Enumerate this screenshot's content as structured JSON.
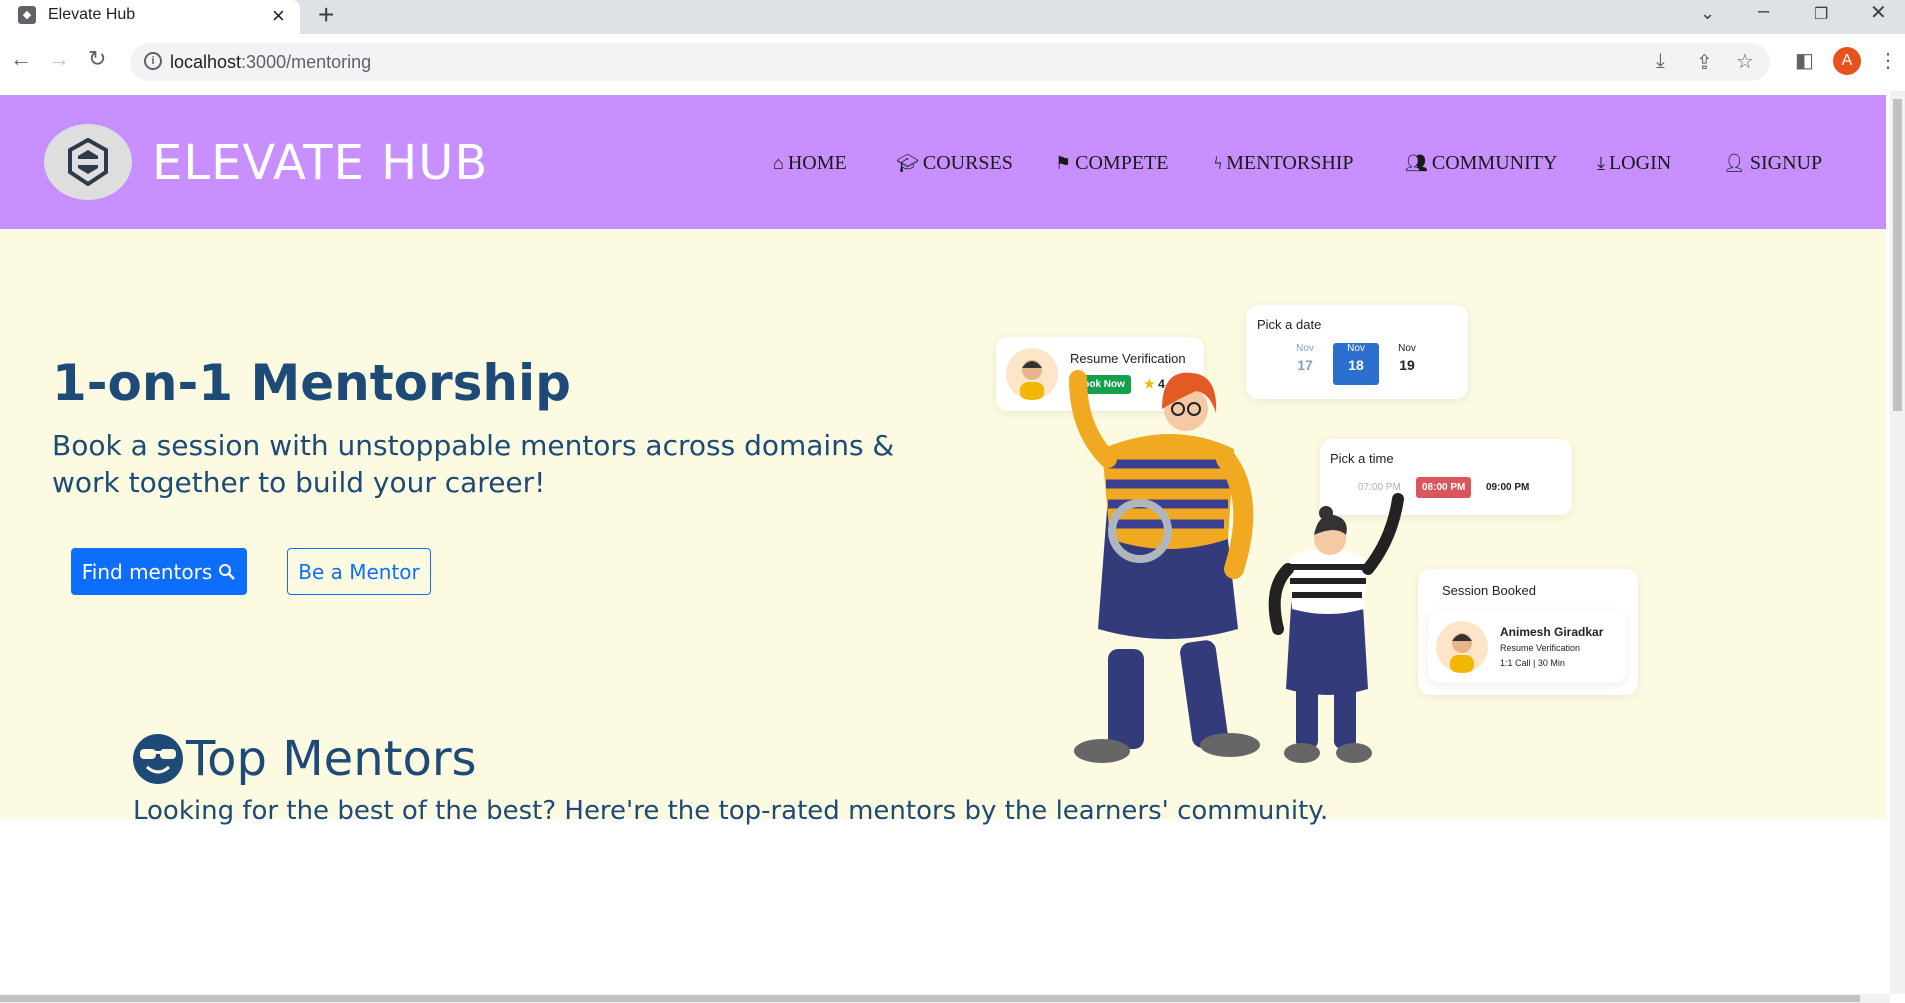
{
  "browser": {
    "tab_title": "Elevate Hub",
    "url_host": "localhost",
    "url_rest": ":3000/mentoring",
    "profile_initial": "A"
  },
  "site": {
    "brand": "ELEVATE HUB",
    "nav": [
      {
        "label": "HOME",
        "icon": "home-icon"
      },
      {
        "label": "COURSES",
        "icon": "graduation-cap-icon"
      },
      {
        "label": "COMPETE",
        "icon": "flag-icon"
      },
      {
        "label": "MENTORSHIP",
        "icon": "bolt-icon"
      },
      {
        "label": "COMMUNITY",
        "icon": "users-icon"
      },
      {
        "label": "LOGIN",
        "icon": "download-icon"
      },
      {
        "label": "SIGNUP",
        "icon": "user-plus-icon"
      }
    ]
  },
  "hero": {
    "title": "1-on-1 Mentorship",
    "subtitle": "Book a session with unstoppable mentors across domains & work together to build your career!",
    "find_button": "Find mentors",
    "mentor_button": "Be a Mentor"
  },
  "illustration": {
    "resume_card": {
      "title": "Resume Verification",
      "button": "Book Now",
      "rating": "4.9"
    },
    "date_card": {
      "title": "Pick a date",
      "dates": [
        {
          "month": "Nov",
          "day": "17"
        },
        {
          "month": "Nov",
          "day": "18"
        },
        {
          "month": "Nov",
          "day": "19"
        }
      ]
    },
    "time_card": {
      "title": "Pick a time",
      "times": [
        "07:00 PM",
        "08:00 PM",
        "09:00 PM"
      ]
    },
    "session_card": {
      "title": "Session Booked",
      "name": "Animesh Giradkar",
      "service": "Resume Verification",
      "detail": "1:1 Call | 30 Min"
    }
  },
  "top_mentors": {
    "title": "Top Mentors",
    "subtitle": "Looking for the best of the best? Here're the top-rated mentors by the learners' community."
  },
  "colors": {
    "header_bg": "#c78fff",
    "hero_bg": "#fcfbe2",
    "heading_text": "#1e4a77",
    "primary": "#0d6efd",
    "book_now": "#15a04f",
    "selected_time": "#d9565c",
    "selected_date": "#2b6fcf"
  }
}
